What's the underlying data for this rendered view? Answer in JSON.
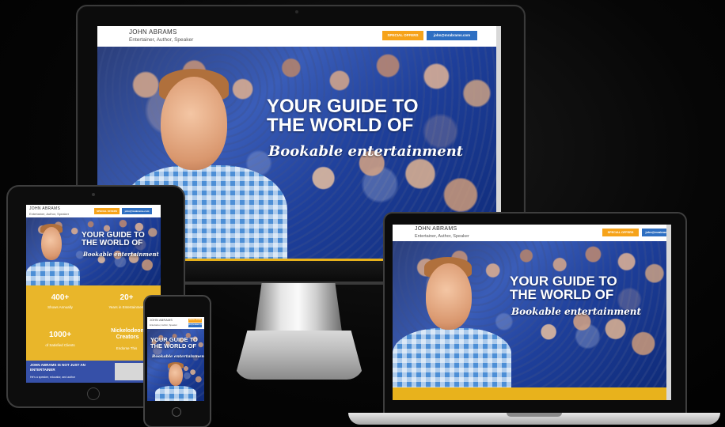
{
  "site": {
    "name": "JOHN ABRAMS",
    "tagline": "Entertainer, Author, Speaker",
    "special_offers": "SPECIAL OFFERS",
    "email": "john@mrabrams.com",
    "headline_line1": "YOUR GUIDE TO",
    "headline_line2": "THE WORLD OF",
    "headline_script": "Bookable entertainment"
  },
  "tablet": {
    "stats": [
      {
        "value": "400+",
        "label": "Shows Annually"
      },
      {
        "value": "20+",
        "label": "Years in Entertainment"
      },
      {
        "value": "1000+",
        "label": "of Satisfied Clients"
      },
      {
        "value": "Nickelodeon Creators",
        "label": "Endorse This"
      }
    ],
    "promo_title": "JOHN ABRAMS IS NOT JUST AN ENTERTAINER",
    "promo_text": "He's a speaker, educator, and author"
  },
  "colors": {
    "accent_orange": "#f6a31a",
    "accent_blue": "#2e6fc2",
    "yellow_band": "#e8b21c",
    "background": "#000000"
  }
}
